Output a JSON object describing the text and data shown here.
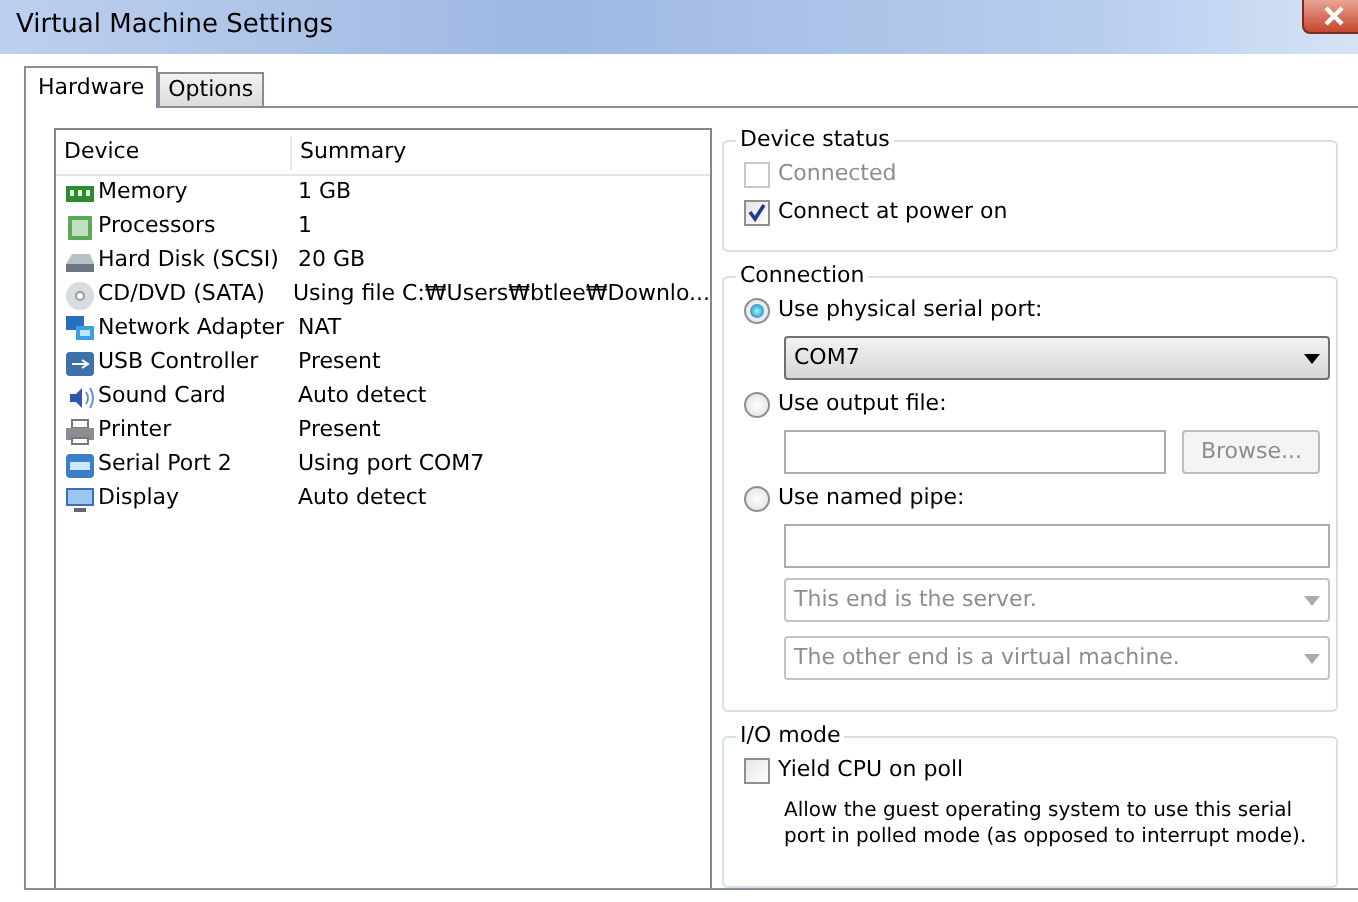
{
  "window": {
    "title": "Virtual Machine Settings"
  },
  "tabs": [
    {
      "label": "Hardware",
      "selected": true
    },
    {
      "label": "Options",
      "selected": false
    }
  ],
  "device_table": {
    "columns": [
      "Device",
      "Summary"
    ],
    "rows": [
      {
        "kind": "memory",
        "device": "Memory",
        "summary": "1 GB"
      },
      {
        "kind": "processor",
        "device": "Processors",
        "summary": "1"
      },
      {
        "kind": "disk",
        "device": "Hard Disk (SCSI)",
        "summary": "20 GB"
      },
      {
        "kind": "cd",
        "device": "CD/DVD (SATA)",
        "summary": "Using file C:₩Users₩btlee₩Downlo..."
      },
      {
        "kind": "network",
        "device": "Network Adapter",
        "summary": "NAT"
      },
      {
        "kind": "usb",
        "device": "USB Controller",
        "summary": "Present"
      },
      {
        "kind": "sound",
        "device": "Sound Card",
        "summary": "Auto detect"
      },
      {
        "kind": "printer",
        "device": "Printer",
        "summary": "Present"
      },
      {
        "kind": "serial",
        "device": "Serial Port 2",
        "summary": "Using port COM7"
      },
      {
        "kind": "display",
        "device": "Display",
        "summary": "Auto detect"
      }
    ]
  },
  "device_status": {
    "title": "Device status",
    "options": [
      {
        "label": "Connected",
        "checked": false,
        "disabled": true
      },
      {
        "label": "Connect at power on",
        "checked": true,
        "disabled": false
      }
    ]
  },
  "connection": {
    "title": "Connection",
    "physical": {
      "label": "Use physical serial port:",
      "selected": true,
      "port": {
        "value": "COM7",
        "disabled": false
      }
    },
    "output_file": {
      "label": "Use output file:",
      "selected": false,
      "browse": {
        "label": "Browse...",
        "disabled": true
      }
    },
    "named_pipe": {
      "label": "Use named pipe:",
      "selected": false,
      "ends": [
        {
          "value": "This end is the server.",
          "disabled": true
        },
        {
          "value": "The other end is a virtual machine.",
          "disabled": true
        }
      ]
    }
  },
  "io_mode": {
    "title": "I/O mode",
    "yield": {
      "label": "Yield CPU on poll",
      "checked": false
    },
    "description": "Allow the guest operating system to use this serial port in polled mode (as opposed to interrupt mode)."
  }
}
